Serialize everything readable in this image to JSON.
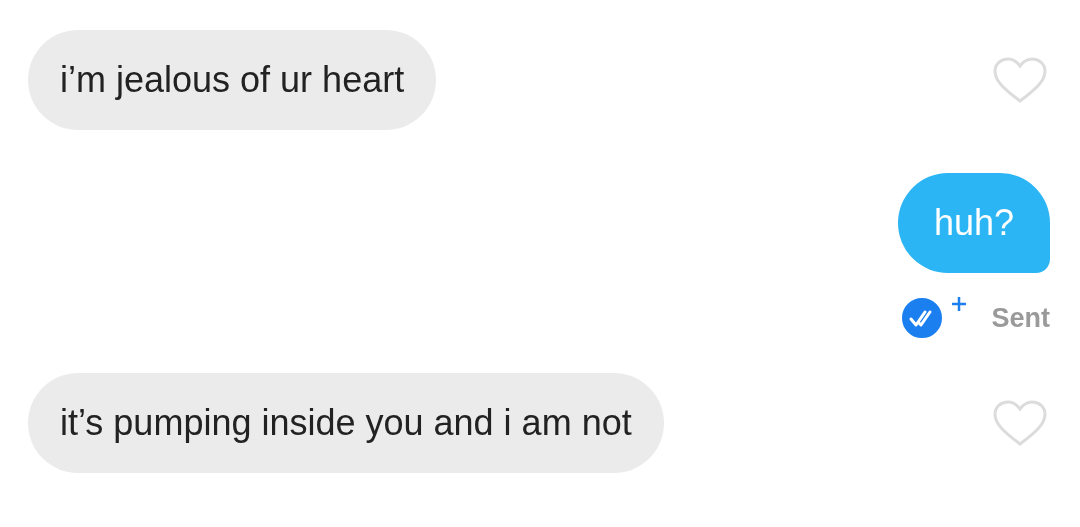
{
  "messages": [
    {
      "kind": "incoming",
      "text": "i’m jealous of ur heart",
      "liked": false
    },
    {
      "kind": "outgoing",
      "text": "huh?",
      "status": "Sent"
    },
    {
      "kind": "incoming",
      "text": "it’s pumping inside you and i am not",
      "liked": false
    }
  ]
}
